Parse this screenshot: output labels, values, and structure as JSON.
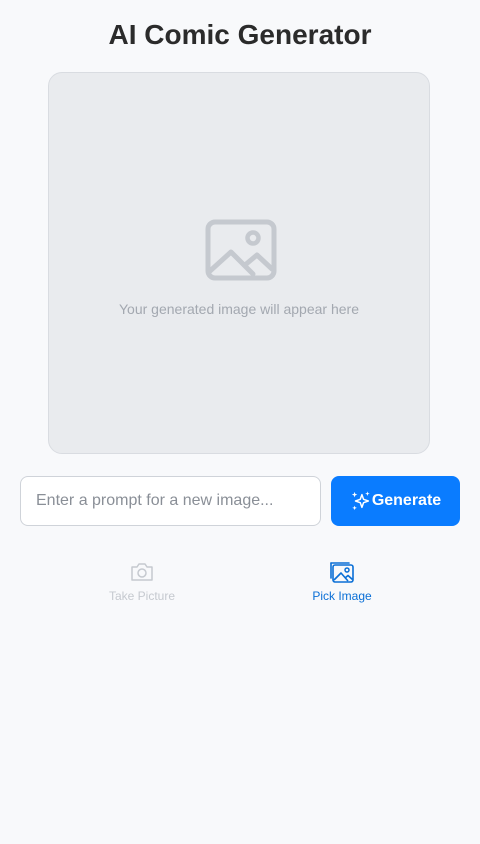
{
  "header": {
    "title": "AI Comic Generator"
  },
  "preview": {
    "icon": "image-placeholder-icon",
    "placeholder_text": "Your generated image will appear here"
  },
  "prompt": {
    "value": "",
    "placeholder": "Enter a prompt for a new image..."
  },
  "generate": {
    "label": "Generate",
    "icon": "sparkles-icon",
    "color": "#0a7cff"
  },
  "actions": {
    "take_picture": {
      "label": "Take Picture",
      "icon": "camera-icon",
      "state": "disabled"
    },
    "pick_image": {
      "label": "Pick Image",
      "icon": "image-icon",
      "color": "#0a6fd6"
    }
  }
}
